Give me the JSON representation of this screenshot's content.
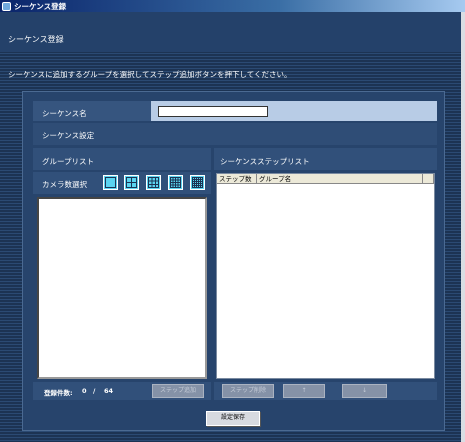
{
  "window": {
    "title": "シーケンス登録"
  },
  "header": {
    "title": "シーケンス登録"
  },
  "instruction": "シーケンスに追加するグループを選択してステップ追加ボタンを押下してください。",
  "sequence_name": {
    "label": "シーケンス名",
    "value": ""
  },
  "sequence_setting": {
    "label": "シーケンス設定"
  },
  "group_list": {
    "label": "グループリスト",
    "camera_count_label": "カメラ数選択",
    "split_options": [
      "1-screen-icon",
      "4-split-icon",
      "9-split-icon",
      "16-split-icon",
      "36-split-icon"
    ],
    "count_label": "登録件数:",
    "count_current": "0",
    "count_sep": "/",
    "count_max": "64",
    "add_step_label": "ステップ追加"
  },
  "step_list": {
    "label": "シーケンスステップリスト",
    "columns": [
      "ステップ数",
      "グループ名"
    ],
    "delete_label": "ステップ削除",
    "up_label": "↑",
    "down_label": "↓"
  },
  "save_label": "設定保存",
  "colors": {
    "accent": "#5ad4f0",
    "panel": "#27446c"
  }
}
